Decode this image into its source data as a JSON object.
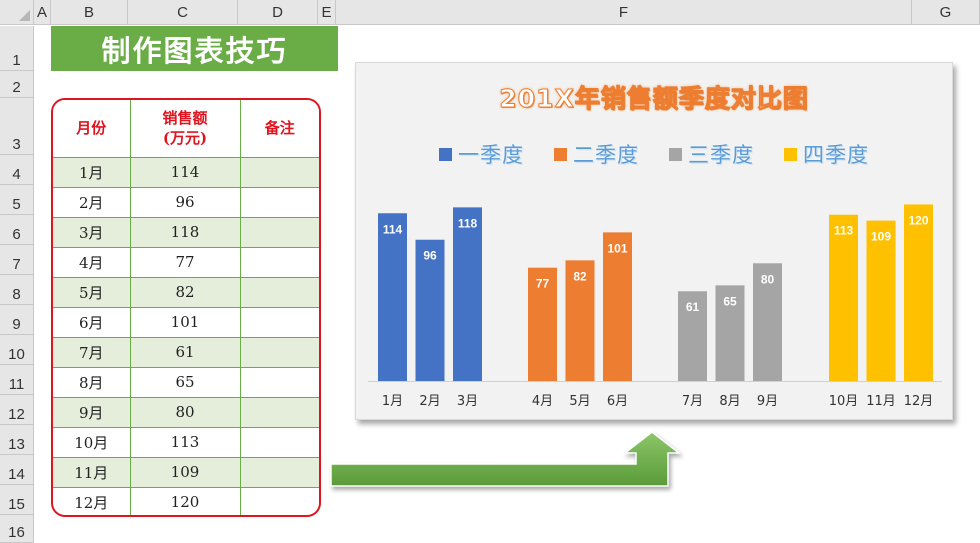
{
  "sheet": {
    "columns": [
      "A",
      "B",
      "C",
      "D",
      "E",
      "F",
      "G"
    ],
    "rows": [
      "1",
      "2",
      "3",
      "4",
      "5",
      "6",
      "7",
      "8",
      "9",
      "10",
      "11",
      "12",
      "13",
      "14",
      "15",
      "16"
    ]
  },
  "banner": {
    "title": "制作图表技巧"
  },
  "table": {
    "headers": {
      "month": "月份",
      "sales_line1": "销售额",
      "sales_line2": "(万元)",
      "note": "备注"
    },
    "rows": [
      {
        "month": "1月",
        "value": "114",
        "note": ""
      },
      {
        "month": "2月",
        "value": "96",
        "note": ""
      },
      {
        "month": "3月",
        "value": "118",
        "note": ""
      },
      {
        "month": "4月",
        "value": "77",
        "note": ""
      },
      {
        "month": "5月",
        "value": "82",
        "note": ""
      },
      {
        "month": "6月",
        "value": "101",
        "note": ""
      },
      {
        "month": "7月",
        "value": "61",
        "note": ""
      },
      {
        "month": "8月",
        "value": "65",
        "note": ""
      },
      {
        "month": "9月",
        "value": "80",
        "note": ""
      },
      {
        "month": "10月",
        "value": "113",
        "note": ""
      },
      {
        "month": "11月",
        "value": "109",
        "note": ""
      },
      {
        "month": "12月",
        "value": "120",
        "note": ""
      }
    ]
  },
  "colors": {
    "banner_green": "#6aac45",
    "table_border_red": "#e0141e",
    "row_shade": "#e4eedb",
    "arrow_green": "#6aac45"
  },
  "chart_data": {
    "type": "bar",
    "title": "201X年销售额季度对比图",
    "ylim": [
      0,
      140
    ],
    "grid": false,
    "legend_position": "top",
    "series": [
      {
        "name": "一季度",
        "color": "#4472c4",
        "categories": [
          "1月",
          "2月",
          "3月"
        ],
        "values": [
          114,
          96,
          118
        ]
      },
      {
        "name": "二季度",
        "color": "#ed7d31",
        "categories": [
          "4月",
          "5月",
          "6月"
        ],
        "values": [
          77,
          82,
          101
        ]
      },
      {
        "name": "三季度",
        "color": "#a5a5a5",
        "categories": [
          "7月",
          "8月",
          "9月"
        ],
        "values": [
          61,
          65,
          80
        ]
      },
      {
        "name": "四季度",
        "color": "#ffc000",
        "categories": [
          "10月",
          "11月",
          "12月"
        ],
        "values": [
          113,
          109,
          120
        ]
      }
    ]
  }
}
